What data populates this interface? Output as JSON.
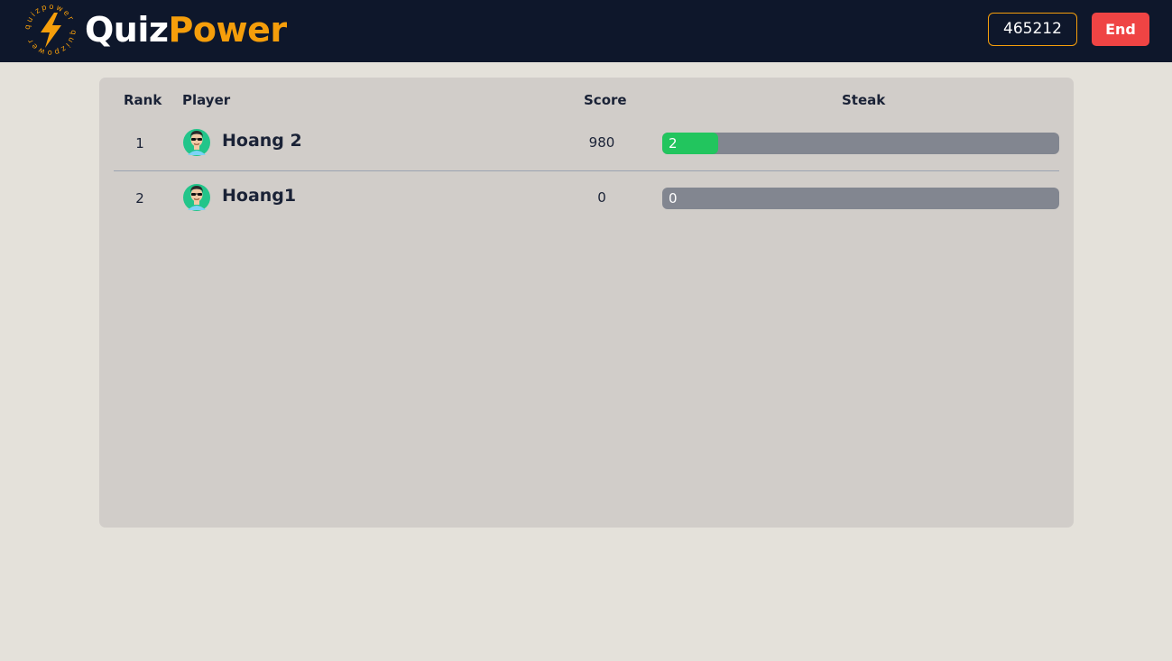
{
  "header": {
    "brand_part1": "Quiz",
    "brand_part2": "Power",
    "badge_text": "quizpower",
    "game_pin": "465212",
    "end_label": "End"
  },
  "leaderboard": {
    "columns": {
      "rank": "Rank",
      "player": "Player",
      "score": "Score",
      "streak": "Steak"
    },
    "rows": [
      {
        "rank": "1",
        "name": "Hoang 2",
        "score": "980",
        "streak": "2",
        "streak_fraction": 0.14
      },
      {
        "rank": "2",
        "name": "Hoang1",
        "score": "0",
        "streak": "0",
        "streak_fraction": 0
      }
    ]
  },
  "colors": {
    "topbar": "#0e172b",
    "accent": "#f59e0b",
    "end_button": "#ef4444",
    "streak_fill": "#22c55e",
    "streak_track": "#828690"
  }
}
